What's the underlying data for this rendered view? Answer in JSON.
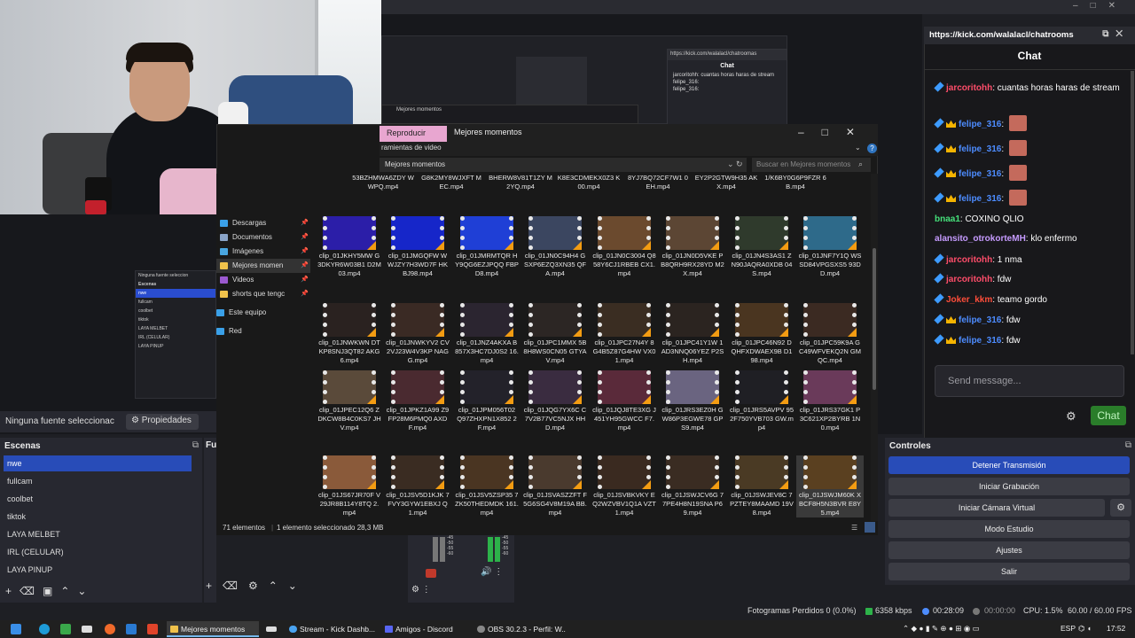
{
  "obs": {
    "no_source": "Ninguna fuente seleccionac",
    "properties": "Propiedades",
    "scenes_title": "Escenas",
    "scenes": [
      "nwe",
      "fullcam",
      "coolbet",
      "tiktok",
      "LAYA MELBET",
      "IRL (CELULAR)",
      "LAYA PINUP"
    ],
    "fuentes_title": "Fu",
    "controls_title": "Controles",
    "controls": [
      "Detener Transmisión",
      "Iniciar Grabación",
      "Iniciar Cámara Virtual",
      "Modo Estudio",
      "Ajustes",
      "Salir"
    ],
    "status": {
      "dropped": "Fotogramas Perdidos 0 (0.0%)",
      "bitrate": "6358 kbps",
      "live_time": "00:28:09",
      "rec_time": "00:00:00",
      "cpu": "CPU: 1.5%",
      "fps": "60.00 / 60.00 FPS"
    },
    "mixer_ticks": [
      "-45",
      "-50",
      "-55",
      "-60"
    ]
  },
  "nested": {
    "chat_url": "https://kick.com/walalacl/chatroomas",
    "chat_title": "Chat",
    "chat_lines": [
      "jarcoritohh: cuantas horas haras de stream",
      "felipe_316:",
      "felipe_316:"
    ],
    "no_source": "Ninguna fuente seleccion",
    "scenes_title": "Escenas",
    "scenes": [
      "nwe",
      "fullcam",
      "coolbet",
      "tiktok",
      "LAYA MELBET",
      "IRL (CELULAR)",
      "LAYA PINUP"
    ],
    "overlay_title": "Mejores momentos"
  },
  "explorer": {
    "tab_play": "Reproducir",
    "title": "Mejores momentos",
    "tools_label": "ramientas de video",
    "address": "Mejores momentos",
    "search_placeholder": "Buscar en Mejores momentos",
    "nav": [
      {
        "label": "Descargas",
        "color": "#3aa0e8",
        "pinned": true,
        "selected": false
      },
      {
        "label": "Documentos",
        "color": "#8aa4c8",
        "pinned": true,
        "selected": false
      },
      {
        "label": "Imágenes",
        "color": "#49a6e0",
        "pinned": true,
        "selected": false
      },
      {
        "label": "Mejores momen",
        "color": "#f0c24b",
        "pinned": true,
        "selected": true
      },
      {
        "label": "Videos",
        "color": "#9b59d0",
        "pinned": true,
        "selected": false
      },
      {
        "label": "shorts que tengc",
        "color": "#f0c24b",
        "pinned": true,
        "selected": false
      },
      {
        "label": "Este equipo",
        "color": "#3aa0e8",
        "pinned": false,
        "selected": false
      },
      {
        "label": "Red",
        "color": "#3aa0e8",
        "pinned": false,
        "selected": false
      }
    ],
    "top_row": [
      "53BZHMWA6ZDY WWPQ.mp4",
      "G8K2MY8WJXFT MEC.mp4",
      "BHERW8V81T1ZY M2YQ.mp4",
      "K8E3CDMEKX0Z3 K00.mp4",
      "8YJ7BQ72CF7W1 0EH.mp4",
      "EY2P2GTW9H35 AKX.mp4",
      "1/K6BY0G6P9FZR 6B.mp4"
    ],
    "rows": [
      [
        {
          "name": "clip_01JKHY5MW G3DKYR6W03B1 D2M03.mp4",
          "color": "#2b1ea8"
        },
        {
          "name": "clip_01JMGQFW WWJZY7H3WD7F HKBJ98.mp4",
          "color": "#1626c9"
        },
        {
          "name": "clip_01JMRMTQR HY9QG6EZJPQQ FBPD8.mp4",
          "color": "#1f3fd6"
        },
        {
          "name": "clip_01JN0C94H4 GSXP6EZQ3XN35 QFA.mp4",
          "color": "#3b4660"
        },
        {
          "name": "clip_01JN0C3004 Q858Y6CJ1RBEB CX1.mp4",
          "color": "#6b4a2e"
        },
        {
          "name": "clip_01JN0D5VKE PB8QRH9RX28YD M2X.mp4",
          "color": "#5c4634"
        },
        {
          "name": "clip_01JN4S3AS1 ZN90JAQRA0XDB 04S.mp4",
          "color": "#2f3a2c"
        },
        {
          "name": "clip_01JNF7Y1Q WSSD84VPGSXS5 93DD.mp4",
          "color": "#2e6a8a"
        }
      ],
      [
        {
          "name": "clip_01JNWKWN DTKP8SNJ3QT82 AKG6.mp4",
          "color": "#2a2220"
        },
        {
          "name": "clip_01JNWKYV2 CV2VJ23W4V3KP NAGG.mp4",
          "color": "#3a2a24"
        },
        {
          "name": "clip_01JNZ4AKXA B857X3HC7DJ0S2 16.mp4",
          "color": "#2b2530"
        },
        {
          "name": "clip_01JPC1MMX 5B8H8WS0CN05 GTYAV.mp4",
          "color": "#2c2624"
        },
        {
          "name": "clip_01JPC27N4Y 8G4B5Z87G4HW VX01.mp4",
          "color": "#3a2d22"
        },
        {
          "name": "clip_01JPC41Y1W 1AD3NNQ06YEZ P2SH.mp4",
          "color": "#2b2420"
        },
        {
          "name": "clip_01JPC46N92 DQHFXDWAEX9B D198.mp4",
          "color": "#4a3520"
        },
        {
          "name": "clip_01JPC59K9A GC49WFVEKQ2N GMQC.mp4",
          "color": "#3b2a22"
        }
      ],
      [
        {
          "name": "clip_01JPEC12Q6 ZDKCW8B4C0KS7 JHV.mp4",
          "color": "#5a4a3a"
        },
        {
          "name": "clip_01JPKZ1A99 Z9FP28M6PMQ0 AXDF.mp4",
          "color": "#4a2a30"
        },
        {
          "name": "clip_01JPM056T02 Q97ZHXPN1X852 2F.mp4",
          "color": "#23222a"
        },
        {
          "name": "clip_01JQG7YX6C C7V2B77VC5NJX HHD.mp4",
          "color": "#3a2c40"
        },
        {
          "name": "clip_01JQJ8TE3XG J451YH95GWCC F7.mp4",
          "color": "#5a2a3a"
        },
        {
          "name": "clip_01JRS3EZ0H GW86P3EGWE78 GPS9.mp4",
          "color": "#6a6480"
        },
        {
          "name": "clip_01JRS5AVPV 952F750YVB703 GW.mp4",
          "color": "#1f1f24"
        },
        {
          "name": "clip_01JRS37GK1 P3C621XP2BYRB 1N0.mp4",
          "color": "#6a3a5a"
        }
      ],
      [
        {
          "name": "clip_01JS67JR70F V29JR8B114Y8TQ 2.mp4",
          "color": "#8a5a3a"
        },
        {
          "name": "clip_01JSV5D1KJK 7FVY3GYW1EBXJ Q1.mp4",
          "color": "#3a2c22"
        },
        {
          "name": "clip_01JSV5ZSP35 7ZK50THEDMDK 161.mp4",
          "color": "#4a3522"
        },
        {
          "name": "clip_01JSVASZZFT F5G6SG4V8M19A BB.mp4",
          "color": "#4a3a2e"
        },
        {
          "name": "clip_01JSVBKVKY EQ2WZVBV1Q1A VZT1.mp4",
          "color": "#3a2a20"
        },
        {
          "name": "clip_01JSWJCV6G 77PE4H8N19SNA P69.mp4",
          "color": "#3a2c22"
        },
        {
          "name": "clip_01JSWJEV8C 7PZTEY8MAAMD 19V8.mp4",
          "color": "#4a3a24"
        },
        {
          "name": "clip_01JSWJM60K XBCF8H5N3BVR E8Y5.mp4",
          "color": "#5a4020",
          "selected": true
        }
      ]
    ],
    "status_count": "71 elementos",
    "status_selected": "1 elemento seleccionado 28,3 MB"
  },
  "chat": {
    "url": "https://kick.com/walalacl/chatrooms",
    "title": "Chat",
    "messages": [
      {
        "badges": [
          "sword"
        ],
        "user": "jarcoritohh",
        "color": "#ff4d6a",
        "text": ": cuantas horas haras de stream",
        "emote": false
      },
      {
        "badges": [
          "sword",
          "crown"
        ],
        "user": "felipe_316",
        "color": "#4d8cff",
        "text": ":",
        "emote": true
      },
      {
        "badges": [
          "sword",
          "crown"
        ],
        "user": "felipe_316",
        "color": "#4d8cff",
        "text": ":",
        "emote": true
      },
      {
        "badges": [
          "sword",
          "crown"
        ],
        "user": "felipe_316",
        "color": "#4d8cff",
        "text": ":",
        "emote": true
      },
      {
        "badges": [
          "sword",
          "crown"
        ],
        "user": "felipe_316",
        "color": "#4d8cff",
        "text": ":",
        "emote": true
      },
      {
        "badges": [],
        "user": "bnaa1",
        "color": "#45e07a",
        "text": ": COXINO QLIO",
        "emote": false
      },
      {
        "badges": [],
        "user": "alansito_otrokorteMH",
        "color": "#c69bff",
        "text": ": klo enfermo",
        "emote": false
      },
      {
        "badges": [
          "sword"
        ],
        "user": "jarcoritohh",
        "color": "#ff4d6a",
        "text": ": 1 nma",
        "emote": false
      },
      {
        "badges": [
          "sword"
        ],
        "user": "jarcoritohh",
        "color": "#ff4d6a",
        "text": ": fdw",
        "emote": false
      },
      {
        "badges": [
          "sword"
        ],
        "user": "Joker_kkm",
        "color": "#ff4d3a",
        "text": ": teamo gordo",
        "emote": false
      },
      {
        "badges": [
          "sword",
          "crown"
        ],
        "user": "felipe_316",
        "color": "#4d8cff",
        "text": ": fdw",
        "emote": false
      },
      {
        "badges": [
          "sword",
          "crown"
        ],
        "user": "felipe_316",
        "color": "#4d8cff",
        "text": ": fdw",
        "emote": false
      }
    ],
    "input_placeholder": "Send message...",
    "send_label": "Chat"
  },
  "taskbar": {
    "apps": [
      {
        "label": "Mejores momentos",
        "color": "#f0c24b",
        "active": true
      },
      {
        "label": "Stream - Kick Dashb...",
        "color": "#4aa3f0",
        "active": false
      },
      {
        "label": "Amigos - Discord",
        "color": "#5865f2",
        "active": false
      },
      {
        "label": "OBS 30.2.3 - Perfil: W...",
        "color": "#888888",
        "active": false
      }
    ],
    "lang": "ESP",
    "time": "17:52"
  }
}
